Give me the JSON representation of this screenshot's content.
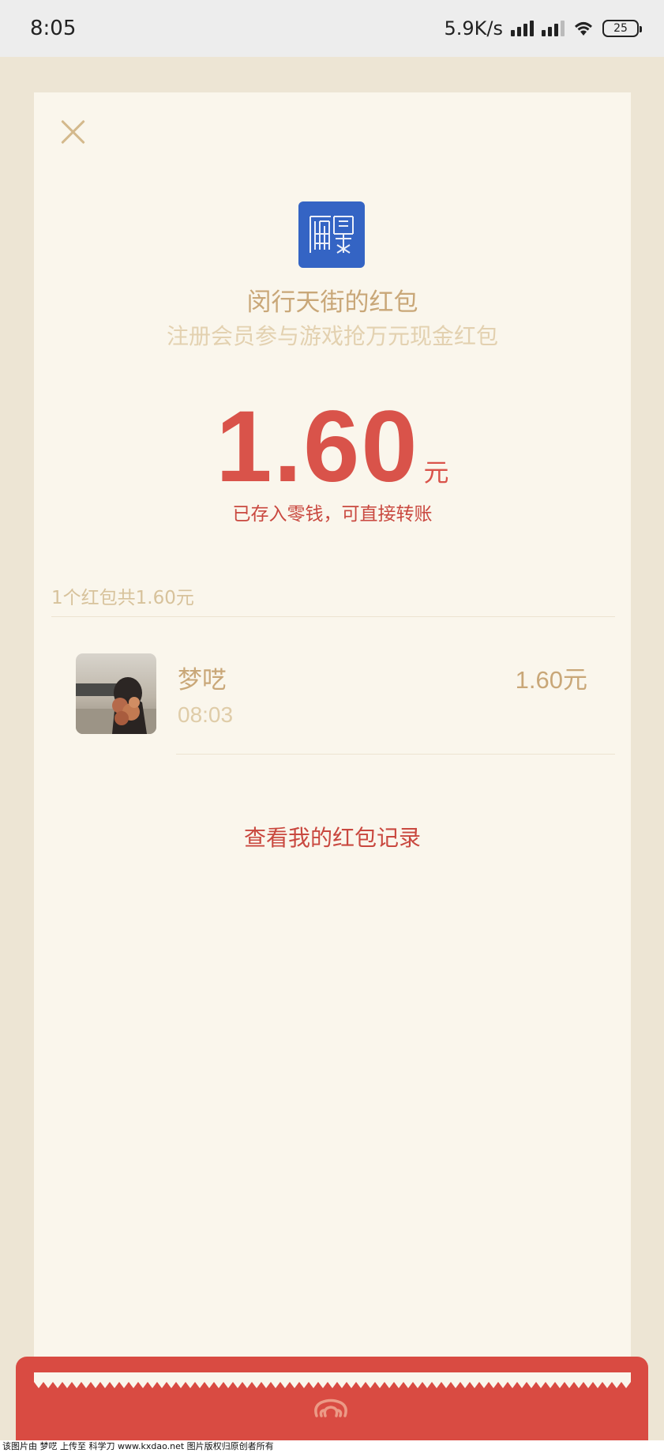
{
  "status_bar": {
    "time": "8:05",
    "net_speed": "5.9K/s",
    "battery_level": "25",
    "icons": [
      "signal-icon",
      "signal-icon",
      "wifi-icon",
      "battery-icon"
    ]
  },
  "card": {
    "close_icon": "close-icon",
    "sender_logo_icon": "qr-logo-icon",
    "title": "闵行天街的红包",
    "subtitle": "注册会员参与游戏抢万元现金红包",
    "amount": "1.60",
    "amount_unit": "元",
    "stored_note": "已存入零钱，可直接转账",
    "summary": "1个红包共1.60元",
    "receivers": [
      {
        "name": "梦呓",
        "time": "08:03",
        "amount": "1.60元"
      }
    ],
    "history_link": "查看我的红包记录"
  },
  "footer": {
    "emblem_icon": "red-packet-emblem-icon",
    "watermark": "该图片由 梦呓 上传至 科学刀 www.kxdao.net 图片版权归原创者所有"
  },
  "colors": {
    "accent_red": "#d9534a",
    "gold": "#c9a778",
    "card_bg": "#faf6ec",
    "page_bg": "#ede5d4",
    "logo_blue": "#3464c4"
  }
}
